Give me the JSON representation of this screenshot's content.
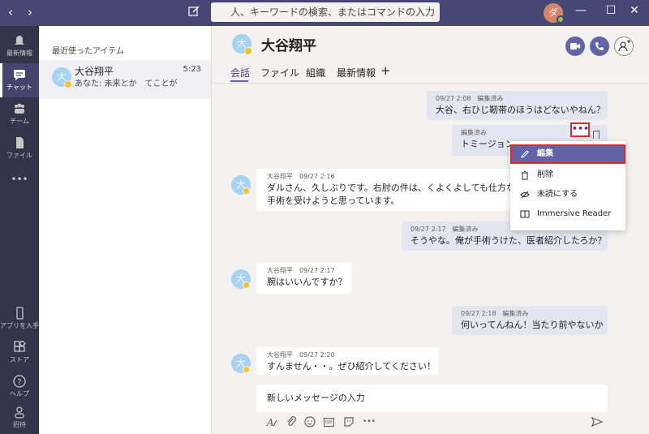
{
  "titlebar": {
    "back_glyph": "‹",
    "forward_glyph": "›",
    "search_placeholder": "人、キーワードの検索、またはコマンドの入力",
    "avatar_initial": "ダ",
    "minimize_glyph": "—",
    "maximize_glyph": "☐",
    "close_glyph": "✕"
  },
  "rail": {
    "activity": "最新情報",
    "chat": "チャット",
    "teams": "チーム",
    "files": "ファイル",
    "more": "•••",
    "get_app": "アプリを入手",
    "store": "ストア",
    "help": "ヘルプ",
    "invite": "招待"
  },
  "chatlist": {
    "header": "最近使ったアイテム",
    "items": [
      {
        "avatar": "大",
        "name": "大谷翔平",
        "time": "5:23",
        "preview": "あなた: 未来とか　てことが"
      }
    ]
  },
  "conversation": {
    "avatar": "大",
    "title": "大谷翔平",
    "tabs": [
      "会話",
      "ファイル",
      "組織",
      "最新情報"
    ],
    "add_tab": "+",
    "messages": [
      {
        "meta": "09/27 2:08　編集済み",
        "text": "大谷、右ひじ靭帯のほうはどないやねん？"
      },
      {
        "meta": "編集済み",
        "text": "トミージョン"
      },
      {
        "meta": "大谷翔平　09/27 2:16",
        "text": "ダルさん、久しぶりです。右肘の件は、くよくよしても仕方ないので",
        "text2": "手術を受けようと思っています。"
      },
      {
        "meta": "09/27 2:17　編集済み",
        "text": "そうやな。俺が手術うけた、医者紹介したろか？"
      },
      {
        "meta": "大谷翔平　09/27 2:17",
        "text": "腕はいいんですか？"
      },
      {
        "meta": "09/27 2:18　編集済み",
        "text": "何いってんねん！当たり前やないか"
      },
      {
        "meta": "大谷翔平　09/27 2:20",
        "text": "すんません・・。ぜひ紹介してください！"
      }
    ],
    "more_glyph": "•••"
  },
  "context_menu": {
    "edit": "編集",
    "delete": "削除",
    "mark_unread": "未読にする",
    "immersive_reader": "Immersive Reader"
  },
  "compose": {
    "placeholder": "新しいメッセージの入力",
    "gif": "GIF",
    "more": "•••"
  },
  "colors": {
    "titlebar": "#464775",
    "rail": "#33344a",
    "accent": "#6264a7",
    "highlight_box": "#e02a2a"
  }
}
